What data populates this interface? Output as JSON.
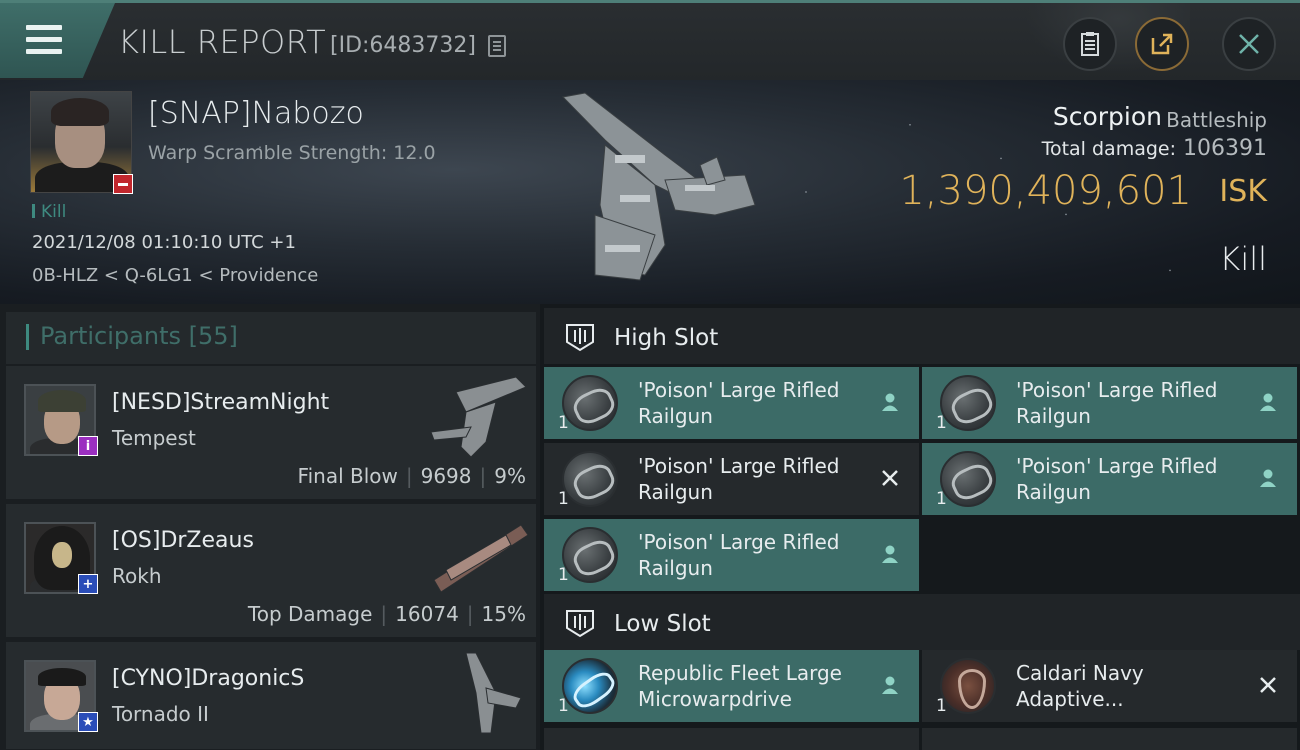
{
  "header": {
    "title": "KILL REPORT",
    "report_id": "[ID:6483732]"
  },
  "victim": {
    "name": "[SNAP]Nabozo",
    "warp": "Warp Scramble Strength: 12.0",
    "tag": "Kill",
    "datetime": "2021/12/08 01:10:10 UTC +1",
    "location": "0B-HLZ < Q-6LG1 < Providence",
    "ship_name": "Scorpion",
    "ship_class": "Battleship",
    "damage_label": "Total damage:",
    "damage_value": "106391",
    "isk_value": "1,390,409,601",
    "isk_unit": "ISK",
    "result": "Kill"
  },
  "participants": {
    "title": "Participants [55]",
    "items": [
      {
        "name": "[NESD]StreamNight",
        "ship": "Tempest",
        "role": "Final Blow",
        "damage": "9698",
        "percent": "9%",
        "badge": "i",
        "badge_color": "#9b2fc0"
      },
      {
        "name": "[OS]DrZeaus",
        "ship": "Rokh",
        "role": "Top Damage",
        "damage": "16074",
        "percent": "15%",
        "badge": "+",
        "badge_color": "#2a4db8"
      },
      {
        "name": "[CYNO]DragonicS",
        "ship": "Tornado II",
        "badge": "★",
        "badge_color": "#2a4db8"
      }
    ]
  },
  "high_slot": {
    "title": "High Slot",
    "modules": [
      {
        "name": "'Poison' Large Rifled Railgun",
        "qty": "1",
        "status": "dropped"
      },
      {
        "name": "'Poison' Large Rifled Railgun",
        "qty": "1",
        "status": "dropped"
      },
      {
        "name": "'Poison' Large Rifled Railgun",
        "qty": "1",
        "status": "destroyed"
      },
      {
        "name": "'Poison' Large Rifled Railgun",
        "qty": "1",
        "status": "dropped"
      },
      {
        "name": "'Poison' Large Rifled Railgun",
        "qty": "1",
        "status": "dropped"
      }
    ]
  },
  "low_slot": {
    "title": "Low Slot",
    "modules": [
      {
        "name": "Republic Fleet Large Microwarpdrive",
        "qty": "1",
        "status": "dropped"
      },
      {
        "name": "Caldari Navy Adaptive...",
        "qty": "1",
        "status": "destroyed"
      }
    ]
  },
  "colors": {
    "accent_teal": "#3c6b67",
    "isk_gold": "#e0b35a",
    "kill_red": "#c1272d"
  }
}
